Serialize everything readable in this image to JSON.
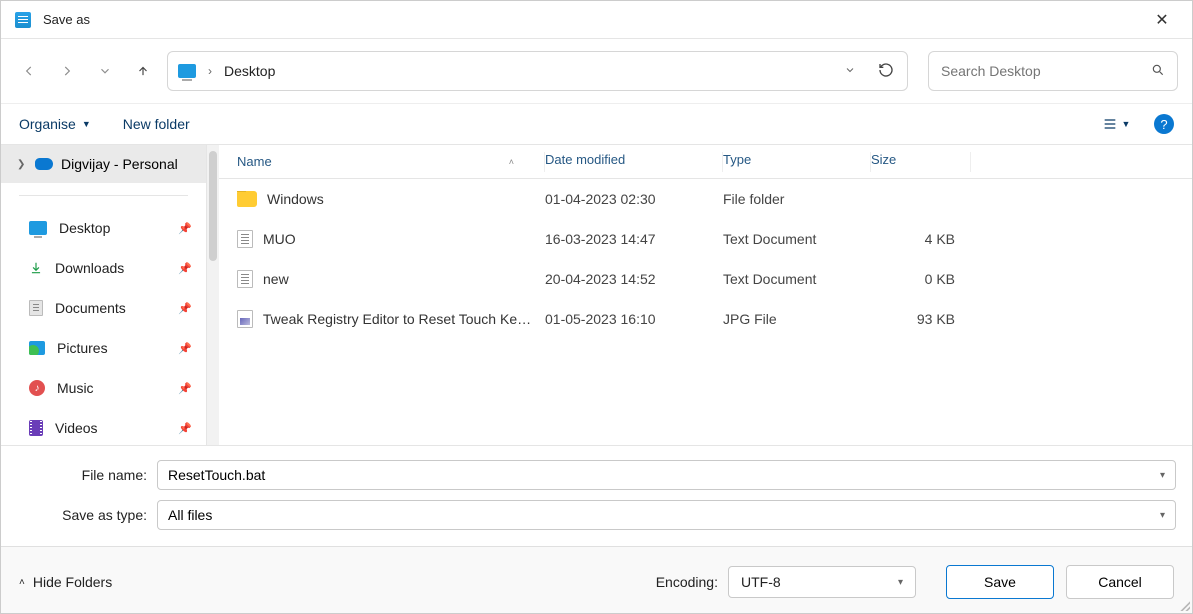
{
  "window_title": "Save as",
  "breadcrumb": {
    "location": "Desktop"
  },
  "search": {
    "placeholder": "Search Desktop"
  },
  "toolbar": {
    "organise": "Organise",
    "new_folder": "New folder"
  },
  "sidebar": {
    "group": "Digvijay - Personal",
    "items": [
      {
        "label": "Desktop"
      },
      {
        "label": "Downloads"
      },
      {
        "label": "Documents"
      },
      {
        "label": "Pictures"
      },
      {
        "label": "Music"
      },
      {
        "label": "Videos"
      }
    ]
  },
  "columns": {
    "name": "Name",
    "date": "Date modified",
    "type": "Type",
    "size": "Size"
  },
  "files": [
    {
      "name": "Windows",
      "date": "01-04-2023 02:30",
      "type": "File folder",
      "size": ""
    },
    {
      "name": "MUO",
      "date": "16-03-2023 14:47",
      "type": "Text Document",
      "size": "4 KB"
    },
    {
      "name": "new",
      "date": "20-04-2023 14:52",
      "type": "Text Document",
      "size": "0 KB"
    },
    {
      "name": "Tweak Registry Editor to Reset Touch Key...",
      "date": "01-05-2023 16:10",
      "type": "JPG File",
      "size": "93 KB"
    }
  ],
  "form": {
    "file_name_label": "File name:",
    "file_name_value": "ResetTouch.bat",
    "save_as_type_label": "Save as type:",
    "save_as_type_value": "All files"
  },
  "bottom": {
    "hide_folders": "Hide Folders",
    "encoding_label": "Encoding:",
    "encoding_value": "UTF-8",
    "save": "Save",
    "cancel": "Cancel"
  }
}
